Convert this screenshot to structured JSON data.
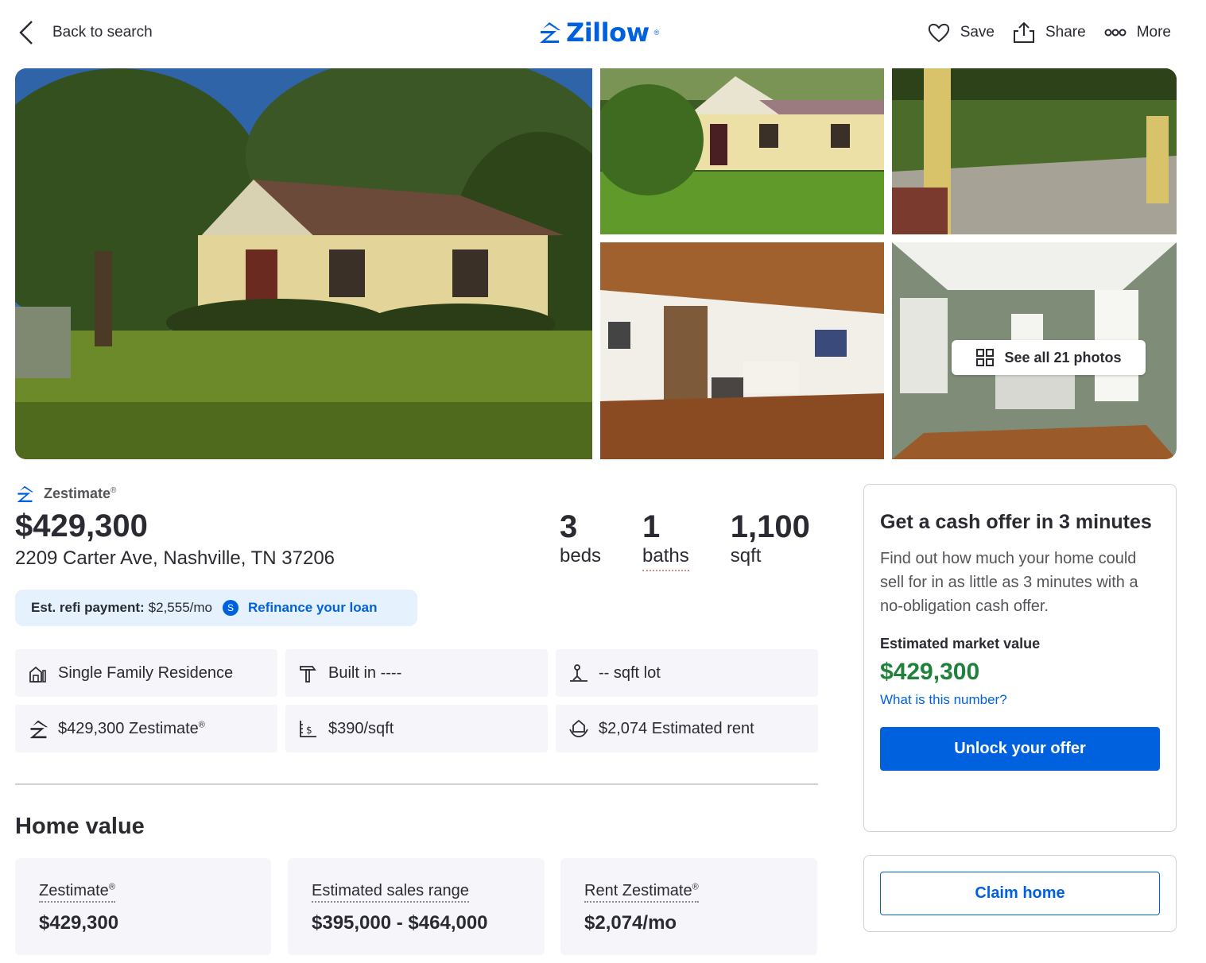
{
  "header": {
    "back_label": "Back to search",
    "logo_text": "Zillow",
    "actions": [
      {
        "label": "Save",
        "icon": "heart-icon"
      },
      {
        "label": "Share",
        "icon": "share-icon"
      },
      {
        "label": "More",
        "icon": "more-icon"
      }
    ]
  },
  "photos": {
    "see_all_label": "See all 21 photos"
  },
  "summary": {
    "zestimate_label": "Zestimate",
    "reg_mark": "®",
    "price": "$429,300",
    "address": "2209 Carter Ave, Nashville, TN 37206",
    "stats": [
      {
        "value": "3",
        "label": "beds"
      },
      {
        "value": "1",
        "label": "baths"
      },
      {
        "value": "1,100",
        "label": "sqft"
      }
    ],
    "refi": {
      "label": "Est. refi payment:",
      "value": "$2,555/mo",
      "badge": "S",
      "link": "Refinance your loan"
    }
  },
  "facts": [
    {
      "text": "Single Family Residence",
      "icon": "home-type-icon"
    },
    {
      "text": "Built in ----",
      "icon": "hammer-icon"
    },
    {
      "text": "-- sqft lot",
      "icon": "lot-icon"
    },
    {
      "text": "$429,300 Zestimate",
      "icon": "zestimate-icon"
    },
    {
      "text": "$390/sqft",
      "icon": "price-per-sqft-icon"
    },
    {
      "text": "$2,074 Estimated rent",
      "icon": "rent-icon"
    }
  ],
  "home_value": {
    "title": "Home value",
    "cards": [
      {
        "label": "Zestimate",
        "value": "$429,300"
      },
      {
        "label": "Estimated sales range",
        "value": "$395,000 - $464,000"
      },
      {
        "label": "Rent Zestimate",
        "value": "$2,074/mo"
      }
    ]
  },
  "cash_offer": {
    "title": "Get a cash offer in 3 minutes",
    "description": "Find out how much your home could sell for in as little as 3 minutes with a no-obligation cash offer.",
    "emv_label": "Estimated market value",
    "emv_value": "$429,300",
    "what_link": "What is this number?",
    "button": "Unlock your offer"
  },
  "claim": {
    "button": "Claim home"
  },
  "colors": {
    "brand_blue": "#0061df",
    "value_green": "#20813b",
    "refi_bg": "#e5f1fc",
    "card_bg": "#f6f6fa"
  }
}
